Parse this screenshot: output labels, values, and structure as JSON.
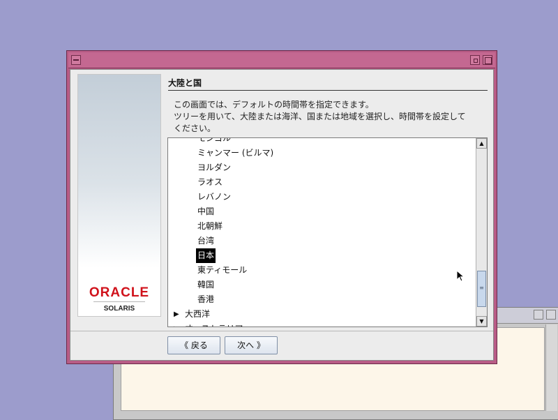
{
  "dialog": {
    "section_title": "大陸と国",
    "description_line1": "この画面では、デフォルトの時間帯を指定できます。",
    "description_line2": "ツリーを用いて、大陸または海洋、国または地域を選択し、時間帯を設定して",
    "description_line3": "ください。",
    "logo": {
      "wordmark": "ORACLE",
      "product": "SOLARIS",
      "brand_color": "#d0121b"
    },
    "tree_items": [
      {
        "label": "モンゴル",
        "kind": "child"
      },
      {
        "label": "ミャンマー (ビルマ)",
        "kind": "child"
      },
      {
        "label": "ヨルダン",
        "kind": "child"
      },
      {
        "label": "ラオス",
        "kind": "child"
      },
      {
        "label": "レバノン",
        "kind": "child"
      },
      {
        "label": "中国",
        "kind": "child"
      },
      {
        "label": "北朝鮮",
        "kind": "child"
      },
      {
        "label": "台湾",
        "kind": "child"
      },
      {
        "label": "日本",
        "kind": "child",
        "selected": true
      },
      {
        "label": "東ティモール",
        "kind": "child"
      },
      {
        "label": "韓国",
        "kind": "child"
      },
      {
        "label": "香港",
        "kind": "child"
      },
      {
        "label": "大西洋",
        "kind": "parent",
        "icon": "expand-triangle-icon"
      },
      {
        "label": "オーストラリア",
        "kind": "parent",
        "icon": "expand-triangle-icon"
      }
    ],
    "buttons": {
      "back_label": "《 戻る",
      "next_label": "次へ 》"
    }
  },
  "colors": {
    "desktop": "#9c9ccc",
    "title_bar": "#c46891",
    "selection_bg": "#000000"
  }
}
